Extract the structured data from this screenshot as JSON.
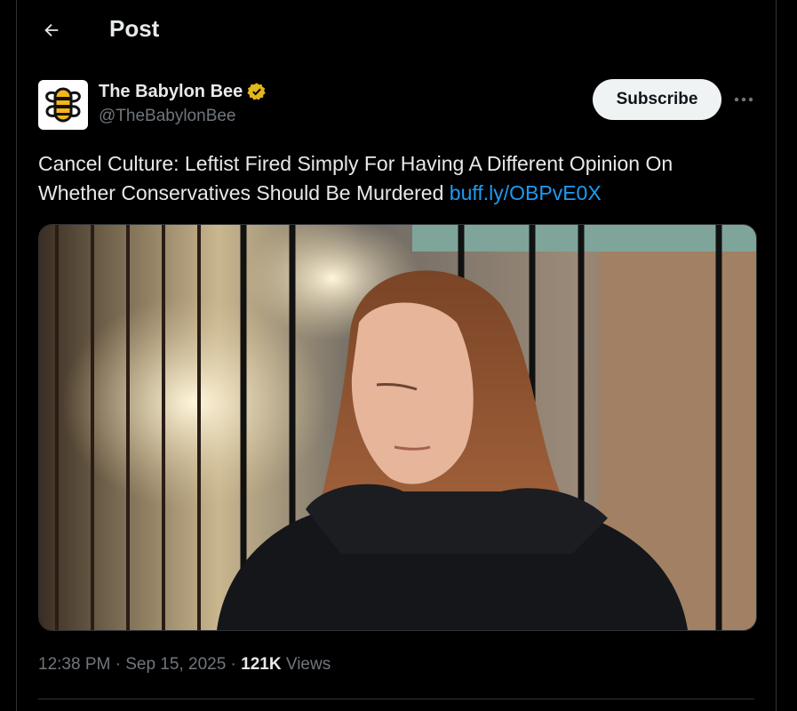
{
  "header": {
    "title": "Post",
    "back_icon": "arrow-left-icon"
  },
  "post": {
    "author": {
      "name": "The Babylon Bee",
      "handle": "@TheBabylonBee",
      "verified_badge": "verified-badge-icon",
      "verified_color": "#e2b719",
      "avatar_icon": "bee-logo-icon"
    },
    "subscribe_label": "Subscribe",
    "more_icon": "more-horizontal-icon",
    "text": "Cancel Culture: Leftist Fired Simply For Having A Different Opinion On Whether Conservatives Should Be Murdered ",
    "link_text": "buff.ly/OBPvE0X",
    "link_color": "#1d9bf0",
    "time": "12:38 PM",
    "date": "Sep 15, 2025",
    "views_count": "121K",
    "views_label": "Views",
    "separator": "·"
  }
}
